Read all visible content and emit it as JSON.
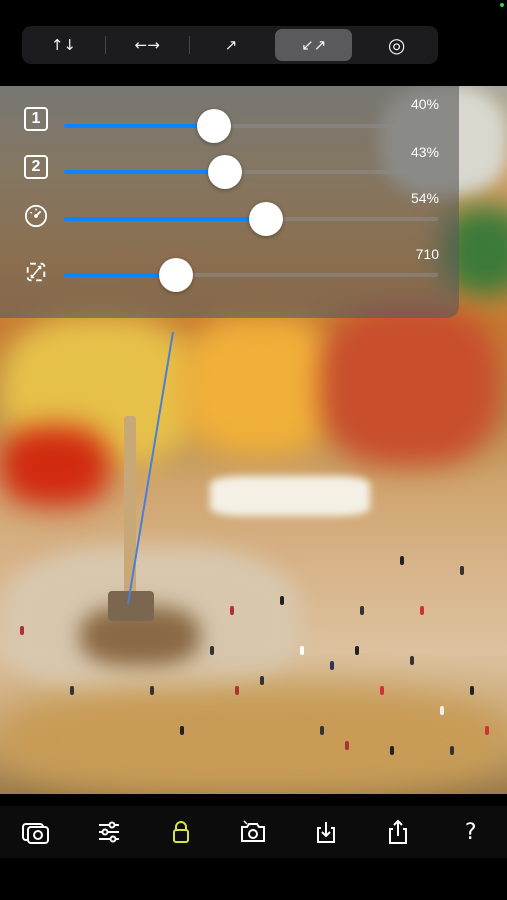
{
  "top_modes": [
    {
      "name": "vertical",
      "icon": "up-down-arrows-icon",
      "glyph": "↑↓",
      "active": false
    },
    {
      "name": "horizontal",
      "icon": "left-right-arrows-icon",
      "glyph": "←→",
      "active": false
    },
    {
      "name": "diagonal",
      "icon": "arrow-up-right-icon",
      "glyph": "↗",
      "active": false
    },
    {
      "name": "diagonal-inward",
      "icon": "arrows-diagonal-in-icon",
      "glyph": "↙↗",
      "active": true
    },
    {
      "name": "radial",
      "icon": "radial-target-icon",
      "glyph": "◎",
      "active": false
    }
  ],
  "sliders": [
    {
      "icon": "number-1-box-icon",
      "label": "1",
      "value": 40,
      "display": "40%"
    },
    {
      "icon": "number-2-box-icon",
      "label": "2",
      "value": 43,
      "display": "43%"
    },
    {
      "icon": "speedometer-icon",
      "label": "",
      "value": 54,
      "display": "54%"
    },
    {
      "icon": "resize-rotate-icon",
      "label": "",
      "value": 30,
      "display": "710"
    }
  ],
  "toolbar": [
    {
      "icon": "gallery-camera-icon"
    },
    {
      "icon": "sliders-adjust-icon"
    },
    {
      "icon": "lock-icon",
      "color": "#d7e34a"
    },
    {
      "icon": "camera-flip-icon"
    },
    {
      "icon": "download-icon"
    },
    {
      "icon": "share-icon"
    },
    {
      "icon": "help-icon",
      "glyph": "?"
    }
  ],
  "colors": {
    "accent": "#0a84ff",
    "lock": "#d7e34a"
  }
}
